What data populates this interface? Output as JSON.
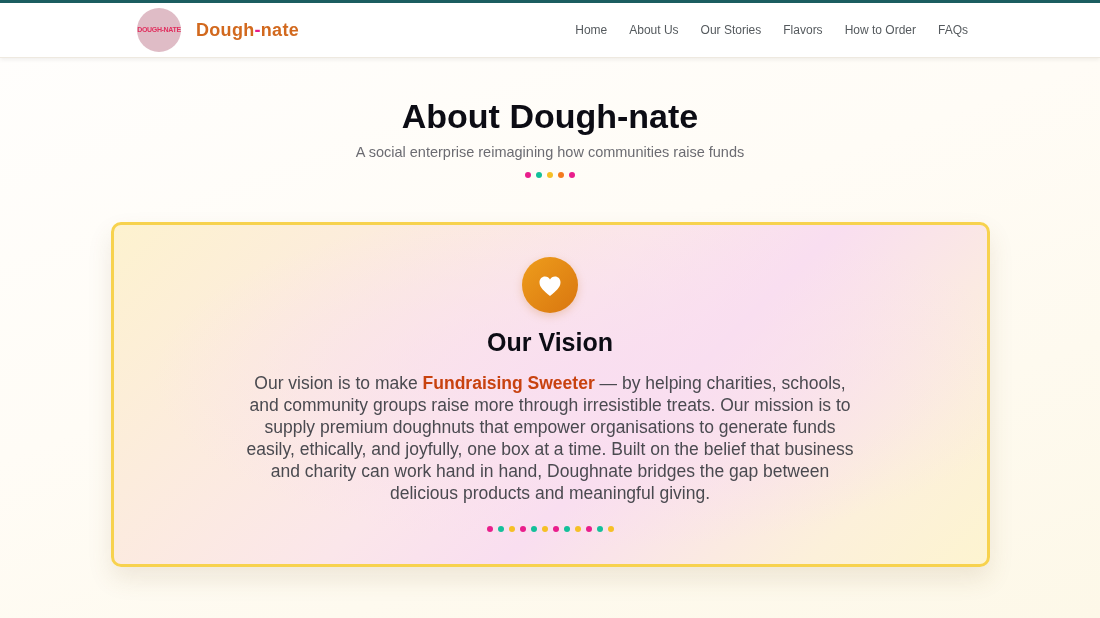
{
  "nav": {
    "logo_text": "DOUGH-NATE",
    "brand": [
      {
        "text": "Dough",
        "color": "#d2691e"
      },
      {
        "text": "-",
        "color": "#e8198b"
      },
      {
        "text": "nate",
        "color": "#d2691e"
      }
    ],
    "links": [
      "Home",
      "About Us",
      "Our Stories",
      "Flavors",
      "How to Order",
      "FAQs"
    ]
  },
  "hero": {
    "title": "About Dough-nate",
    "subtitle": "A social enterprise reimagining how communities raise funds",
    "dots": [
      {
        "color": "#e91e8c"
      },
      {
        "color": "#14c09a"
      },
      {
        "color": "#f6c026"
      },
      {
        "color": "#f47a1f"
      },
      {
        "color": "#e91e8c"
      }
    ]
  },
  "vision_card": {
    "title": "Our Vision",
    "text": "Our vision is to make **Fundraising Sweeter** — by helping charities, schools, and community groups raise more through irresistible treats. Our mission is to supply premium doughnuts that empower organisations to generate funds easily, ethically, and joyfully, one box at a time. Built on the belief that business and charity can work hand in hand, Doughnate bridges the gap between delicious products and meaningful giving.",
    "dots": [
      {
        "color": "#e91e8c"
      },
      {
        "color": "#14c09a"
      },
      {
        "color": "#f6c026"
      },
      {
        "color": "#e91e8c"
      },
      {
        "color": "#14c09a"
      },
      {
        "color": "#f6c026"
      },
      {
        "color": "#e91e8c"
      },
      {
        "color": "#14c09a"
      },
      {
        "color": "#f6c026"
      },
      {
        "color": "#e91e8c"
      },
      {
        "color": "#14c09a"
      },
      {
        "color": "#f6c026"
      }
    ]
  }
}
